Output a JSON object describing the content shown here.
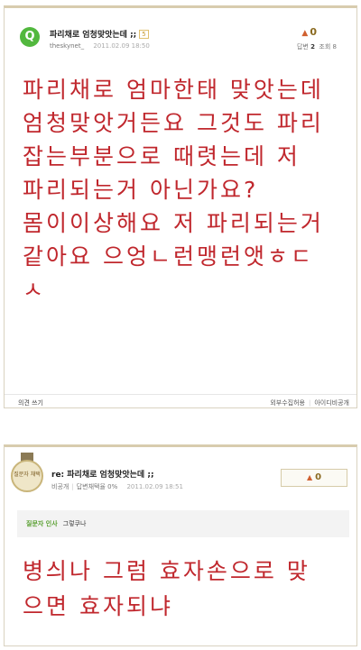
{
  "question": {
    "icon_letter": "Q",
    "title": "파리채로 엄청맞앗는데 ;;",
    "badge": "5",
    "author": "theskynet_",
    "date": "2011.02.09 18:50",
    "votes": "0",
    "answers_label": "답변",
    "answers_count": "2",
    "views_label": "조회",
    "views_count": "8",
    "body_lines": [
      "파리채로 엄마한태 맞앗는데",
      "엄청맞앗거든요 그것도 파리",
      "잡는부분으로 때렷는데 저",
      "파리되는거 아닌가요?",
      "몸이이상해요 저 파리되는거",
      "같아요 으엉ㄴ런맹런앳ㅎㄷ",
      "ㅅ"
    ],
    "reply_link": "의견 쓰기",
    "option_external": "외부수집허용",
    "option_anonymous": "아이디비공개"
  },
  "answer": {
    "medal_text": "질문자 채택",
    "title": "re: 파리채로 엄청맞앗는데 ;;",
    "author": "비공개",
    "rate": "답변채택율 0%",
    "date": "2011.02.09 18:51",
    "votes": "0",
    "greet_label": "질문자 인사",
    "greet_text": "그렇쿠나",
    "body_lines": [
      "병싀나 그럼 효자손으로 맞",
      "으면 효자되냐"
    ]
  },
  "colors": {
    "body_text": "#c0272d",
    "q_icon": "#52b83e",
    "greet_label": "#5aa032"
  }
}
